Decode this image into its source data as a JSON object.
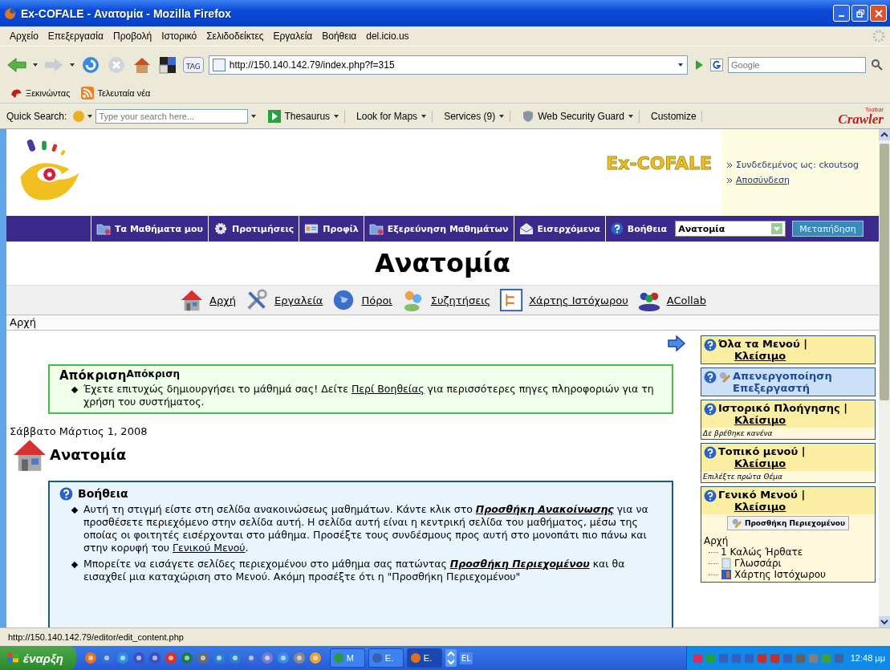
{
  "window": {
    "title": "Ex-COFALE - Ανατομία - Mozilla Firefox"
  },
  "menu_bar": [
    "Αρχείο",
    "Επεξεργασία",
    "Προβολή",
    "Ιστορικό",
    "Σελιδοδείκτες",
    "Εργαλεία",
    "Βοήθεια",
    "del.icio.us"
  ],
  "nav_toolbar": {
    "url": "http://150.140.142.79/index.php?f=315",
    "search_placeholder": "Google",
    "tag_label": "TAG"
  },
  "bookmarks": [
    {
      "label": "Ξεκινώντας",
      "kind": "start"
    },
    {
      "label": "Τελευταία νέα",
      "kind": "rss"
    }
  ],
  "quick_search": {
    "label": "Quick Search:",
    "placeholder": "Type your search here...",
    "buttons": [
      {
        "label": "Thesaurus",
        "kind": "play"
      },
      {
        "label": "Look for Maps",
        "kind": "plain"
      },
      {
        "label": "Services (9)",
        "kind": "plain"
      },
      {
        "label": "Web Security Guard",
        "kind": "shield"
      },
      {
        "label": "Customize",
        "kind": "none"
      }
    ],
    "brand": "Crawler",
    "brand_tag": "Toolbar"
  },
  "site_header": {
    "logo_text": "Ex-COFALE",
    "logged_in": "Συνδεδεμένος ως: ckoutsog",
    "logout": "Αποσύνδεση"
  },
  "site_nav": {
    "items": [
      {
        "label": "Τα Μαθήματα μου",
        "kind": "folder"
      },
      {
        "label": "Προτιμήσεις",
        "kind": "gear"
      },
      {
        "label": "Προφίλ",
        "kind": "card"
      },
      {
        "label": "Εξερεύνηση Μαθημάτων",
        "kind": "folder"
      },
      {
        "label": "Εισερχόμενα",
        "kind": "mail"
      },
      {
        "label": "Βοήθεια",
        "kind": "help"
      }
    ],
    "course_select": "Ανατομία",
    "jump_button": "Μεταπήδηση"
  },
  "course_title": "Ανατομία",
  "course_tools": [
    {
      "label": "Αρχή",
      "kind": "home"
    },
    {
      "label": "Εργαλεία",
      "kind": "tools"
    },
    {
      "label": "Πόροι",
      "kind": "globe"
    },
    {
      "label": "Συζητήσεις",
      "kind": "people"
    },
    {
      "label": "Χάρτης Ιστόχωρου",
      "kind": "sitemap"
    },
    {
      "label": "ACollab",
      "kind": "group"
    }
  ],
  "breadcrumb": "Αρχή",
  "feedback": {
    "title": "Απόκριση",
    "subtitle": "Απόκριση",
    "items": [
      [
        {
          "kind": "text",
          "text": "Έχετε επιτυχώς δημιουργήσει το μάθημά σας! Δείτε "
        },
        {
          "kind": "link",
          "text": "Περί Βοηθείας"
        },
        {
          "kind": "text",
          "text": " για περισσότερες πηγες πληροφοριών για τη χρήση του συστήματος."
        }
      ]
    ]
  },
  "date": "Σάββατο Μάρτιος 1, 2008",
  "page_heading": "Ανατομία",
  "help": {
    "title": "Βοήθεια",
    "items": [
      [
        {
          "kind": "text",
          "text": "Αυτή τη στιγμή είστε στη σελίδα ανακοινώσεως μαθημάτων. Κάντε κλικ στο "
        },
        {
          "kind": "strong-link",
          "text": "Προσθήκη Ανακοίνωσης"
        },
        {
          "kind": "text",
          "text": " για να προσθέσετε περιεχόμενο στην σελίδα αυτή. Η σελίδα αυτή είναι η κεντρική σελίδα του μαθήματος, μέσω της οποίας οι φοιτητές εισέρχονται στο μάθημα. Προσέξτε τους συνδέσμους προς αυτή στο μονοπάτι πιο πάνω και στην κορυφή του "
        },
        {
          "kind": "link",
          "text": "Γενικού Μενού"
        },
        {
          "kind": "text",
          "text": "."
        }
      ],
      [
        {
          "kind": "text",
          "text": "Μπορείτε να εισάγετε σελίδες περιεχομένου στο μάθημα σας πατώντας "
        },
        {
          "kind": "strong-link",
          "text": "Προσθήκη Περιεχομένου"
        },
        {
          "kind": "text",
          "text": " και θα εισαχθεί μια καταχώριση στο Μενού. Ακόμη προσέξτε ότι η \"Προσθήκη Περιεχομένου\""
        }
      ]
    ]
  },
  "sidebar": [
    {
      "kind": "menu",
      "title": "Όλα τα Μενού |",
      "close": "Κλείσιμο"
    },
    {
      "kind": "editor",
      "title": "Απενεργοποίηση Επεξεργαστή"
    },
    {
      "kind": "menu",
      "title": "Ιστορικό Πλοήγησης |",
      "close": "Κλείσιμο",
      "note": "Δε βρέθηκε κανένα"
    },
    {
      "kind": "menu",
      "title": "Τοπικό μενού |",
      "close": "Κλείσιμο",
      "note": "Επιλέξτε πρώτα Θέμα"
    },
    {
      "kind": "menu",
      "title": "Γενικό Μενού |",
      "close": "Κλείσιμο",
      "button": "Προσθήκη Περιεχομένου",
      "tree": [
        {
          "label": "Αρχή",
          "children": [
            {
              "label": "1 Καλώς Ήρθατε",
              "kind": "page"
            },
            {
              "label": "Γλωσσάρι",
              "kind": "glossary"
            },
            {
              "label": "Χάρτης Ιστόχωρου",
              "kind": "sitemap"
            }
          ]
        }
      ]
    }
  ],
  "status_bar": "http://150.140.142.79/editor/edit_content.php",
  "taskbar": {
    "start": "έναρξη",
    "tasks": [
      {
        "label": "M",
        "kind": "green",
        "selected": false
      },
      {
        "label": "E.",
        "kind": "doc",
        "selected": false
      },
      {
        "label": "E.",
        "kind": "firefox",
        "selected": true
      }
    ],
    "language": "EL",
    "clock": "12:48 μμ"
  }
}
